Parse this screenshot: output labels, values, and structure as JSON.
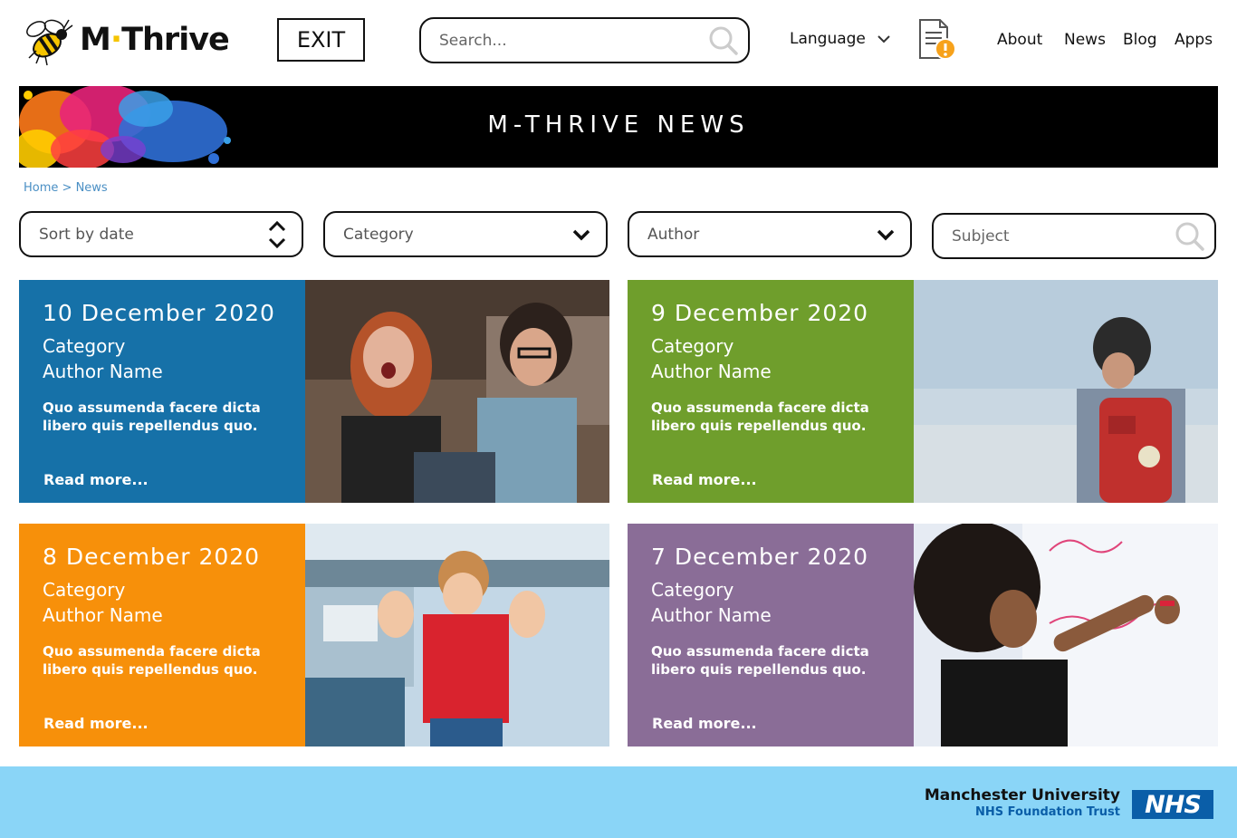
{
  "header": {
    "logo_text_a": "M",
    "logo_text_dot": "·",
    "logo_text_b": "Thrive",
    "exit_label": "EXIT",
    "search_placeholder": "Search...",
    "language_label": "Language",
    "nav": [
      "About",
      "News",
      "Blog",
      "Apps"
    ]
  },
  "banner": {
    "title": "M-THRIVE NEWS"
  },
  "breadcrumb": {
    "home": "Home",
    "separator": " > ",
    "current": "News"
  },
  "filters": {
    "sort": "Sort by date",
    "category": "Category",
    "author": "Author",
    "subject_placeholder": "Subject"
  },
  "cards": [
    {
      "date": "10 December 2020",
      "category": "Category",
      "author": "Author Name",
      "body": "Quo assumenda facere dicta libero quis repellendus quo.",
      "more": "Read more...",
      "color": "#1671a8",
      "image": "two-friends-laughing"
    },
    {
      "date": "9 December 2020",
      "category": "Category",
      "author": "Author Name",
      "body": "Quo assumenda facere dicta libero quis repellendus quo.",
      "more": "Read more...",
      "color": "#6f9e2c",
      "image": "boy-with-red-backpack"
    },
    {
      "date": "8 December 2020",
      "category": "Category",
      "author": "Author Name",
      "body": "Quo assumenda facere dicta libero quis repellendus quo.",
      "more": "Read more...",
      "color": "#f7900a",
      "image": "child-flexing-muscles"
    },
    {
      "date": "7 December 2020",
      "category": "Category",
      "author": "Author Name",
      "body": "Quo assumenda facere dicta libero quis repellendus quo.",
      "more": "Read more...",
      "color": "#8a6d97",
      "image": "woman-writing-on-whiteboard"
    }
  ],
  "footer": {
    "org_line1": "Manchester University",
    "org_line2": "NHS Foundation Trust",
    "nhs_logo": "NHS",
    "background": "#8ad5f7"
  }
}
